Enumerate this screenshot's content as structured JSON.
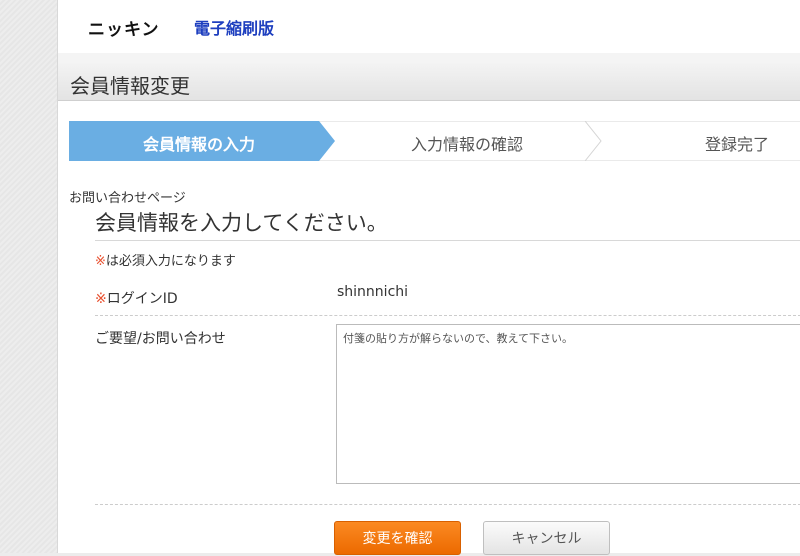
{
  "header": {
    "logo_brand": "ニッキン",
    "logo_product": "電子縮刷版"
  },
  "page_title": "会員情報変更",
  "steps": [
    {
      "label": "会員情報の入力",
      "active": true
    },
    {
      "label": "入力情報の確認",
      "active": false
    },
    {
      "label": "登録完了",
      "active": false
    }
  ],
  "form": {
    "contact_page_label": "お問い合わせページ",
    "heading": "会員情報を入力してください。",
    "required_mark": "※",
    "required_note": "は必須入力になります",
    "login": {
      "label": "ログインID",
      "value": "shinnnichi"
    },
    "inquiry": {
      "label": "ご要望/お問い合わせ",
      "value": "付箋の貼り方が解らないので、教えて下さい。"
    }
  },
  "buttons": {
    "confirm": "変更を確認",
    "cancel": "キャンセル"
  },
  "colors": {
    "active_step": "#6aaee3",
    "required": "#e8502f",
    "confirm_button": "#f57b10"
  }
}
